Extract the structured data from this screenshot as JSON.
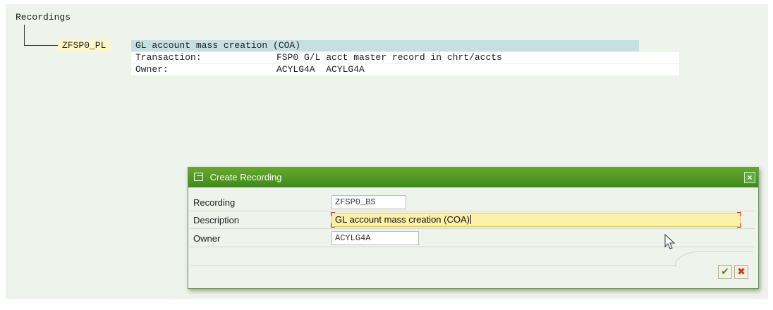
{
  "tree": {
    "title": "Recordings",
    "node": {
      "key": "ZFSP0_PL",
      "description": "GL account mass creation (COA)",
      "rows": [
        {
          "label": "Transaction:",
          "value": "FSP0 G/L acct master record in chrt/accts"
        },
        {
          "label": "Owner:",
          "value": "ACYLG4A  ACYLG4A"
        }
      ]
    }
  },
  "dialog": {
    "title": "Create Recording",
    "close_label": "×",
    "fields": {
      "recording_label": "Recording",
      "recording_value": "ZFSP0_BS",
      "description_label": "Description",
      "description_value": "GL account mass creation (COA)",
      "owner_label": "Owner",
      "owner_value": "ACYLG4A"
    },
    "buttons": {
      "ok_glyph": "✔",
      "cancel_glyph": "✖"
    }
  },
  "colors": {
    "title_bar": "#4f9a24",
    "selected_row": "#c6dfe1",
    "node_key_bg": "#fdf6c8",
    "active_field": "#fdf0a8"
  }
}
